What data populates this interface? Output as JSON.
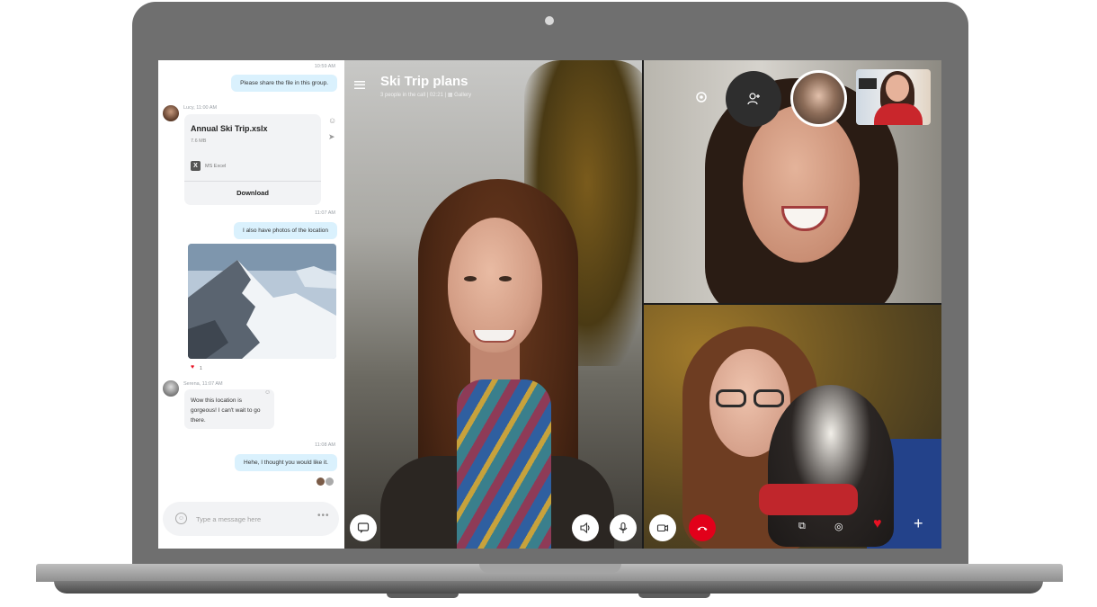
{
  "chat": {
    "messages": {
      "m1_time": "10:59 AM",
      "m1_text": "Please share the file in this group.",
      "lucy_meta": "Lucy, 11:00 AM",
      "file_name": "Annual Ski Trip.xslx",
      "file_size": "7.6 MB",
      "file_app": "MS Excel",
      "download_label": "Download",
      "m2_time": "11:07 AM",
      "m2_text": "I also have photos of the location",
      "reaction_count": "1",
      "serena_meta": "Serena, 11:07 AM",
      "serena_text": "Wow this location is gorgeous! I can't wait to go there.",
      "m3_time": "11:08 AM",
      "m3_text": "Hehe, I thought you would like it."
    },
    "composer": {
      "placeholder": "Type a message here",
      "more": "•••"
    }
  },
  "call": {
    "title": "Ski Trip plans",
    "subtitle": "3 people in the call | 02:21 | ▦ Gallery"
  },
  "icons": [
    "menu-icon",
    "gear-icon",
    "add-person-icon",
    "chat-icon",
    "speaker-icon",
    "microphone-icon",
    "camera-icon",
    "end-call-icon",
    "screen-share-icon",
    "heart-icon",
    "plus-icon",
    "emoji-icon",
    "send-icon",
    "excel-icon"
  ],
  "colors": {
    "accent_bubble": "#daf1fd",
    "end_call": "#e2001a",
    "heart": "#e81123"
  }
}
